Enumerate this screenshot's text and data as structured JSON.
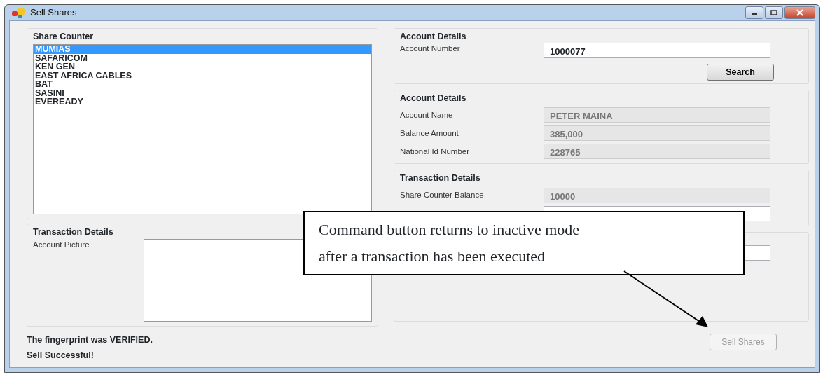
{
  "window": {
    "title": "Sell Shares"
  },
  "share_counter": {
    "title": "Share Counter",
    "items": [
      {
        "label": "MUMIAS",
        "selected": true
      },
      {
        "label": "SAFARICOM",
        "selected": false
      },
      {
        "label": "KEN GEN",
        "selected": false
      },
      {
        "label": "EAST AFRICA CABLES",
        "selected": false
      },
      {
        "label": "BAT",
        "selected": false
      },
      {
        "label": "SASINI",
        "selected": false
      },
      {
        "label": "EVEREADY",
        "selected": false
      }
    ]
  },
  "picture_group": {
    "title": "Transaction Details",
    "label": "Account Picture"
  },
  "account_search": {
    "title": "Account Details",
    "label": "Account Number",
    "value": "1000077",
    "button": "Search"
  },
  "account_details": {
    "title": "Account Details",
    "fields": [
      {
        "label": "Account Name",
        "value": "PETER MAINA",
        "disabled": true
      },
      {
        "label": "Balance Amount",
        "value": "385,000",
        "disabled": true
      },
      {
        "label": "National Id Number",
        "value": "228765",
        "disabled": true
      }
    ]
  },
  "transaction_details": {
    "title": "Transaction Details",
    "fields": [
      {
        "label": "Share Counter Balance",
        "value": "10000",
        "disabled": true
      },
      {
        "disabled": false
      }
    ]
  },
  "extra_group": {
    "fields": [
      {
        "disabled": false
      }
    ]
  },
  "status_lines": [
    "The fingerprint was VERIFIED.",
    "Sell Successful!"
  ],
  "sell_button": {
    "label": "Sell Shares",
    "disabled": true
  },
  "callout": {
    "lines": [
      "Command button returns to inactive mode",
      "after a transaction has been executed"
    ]
  }
}
